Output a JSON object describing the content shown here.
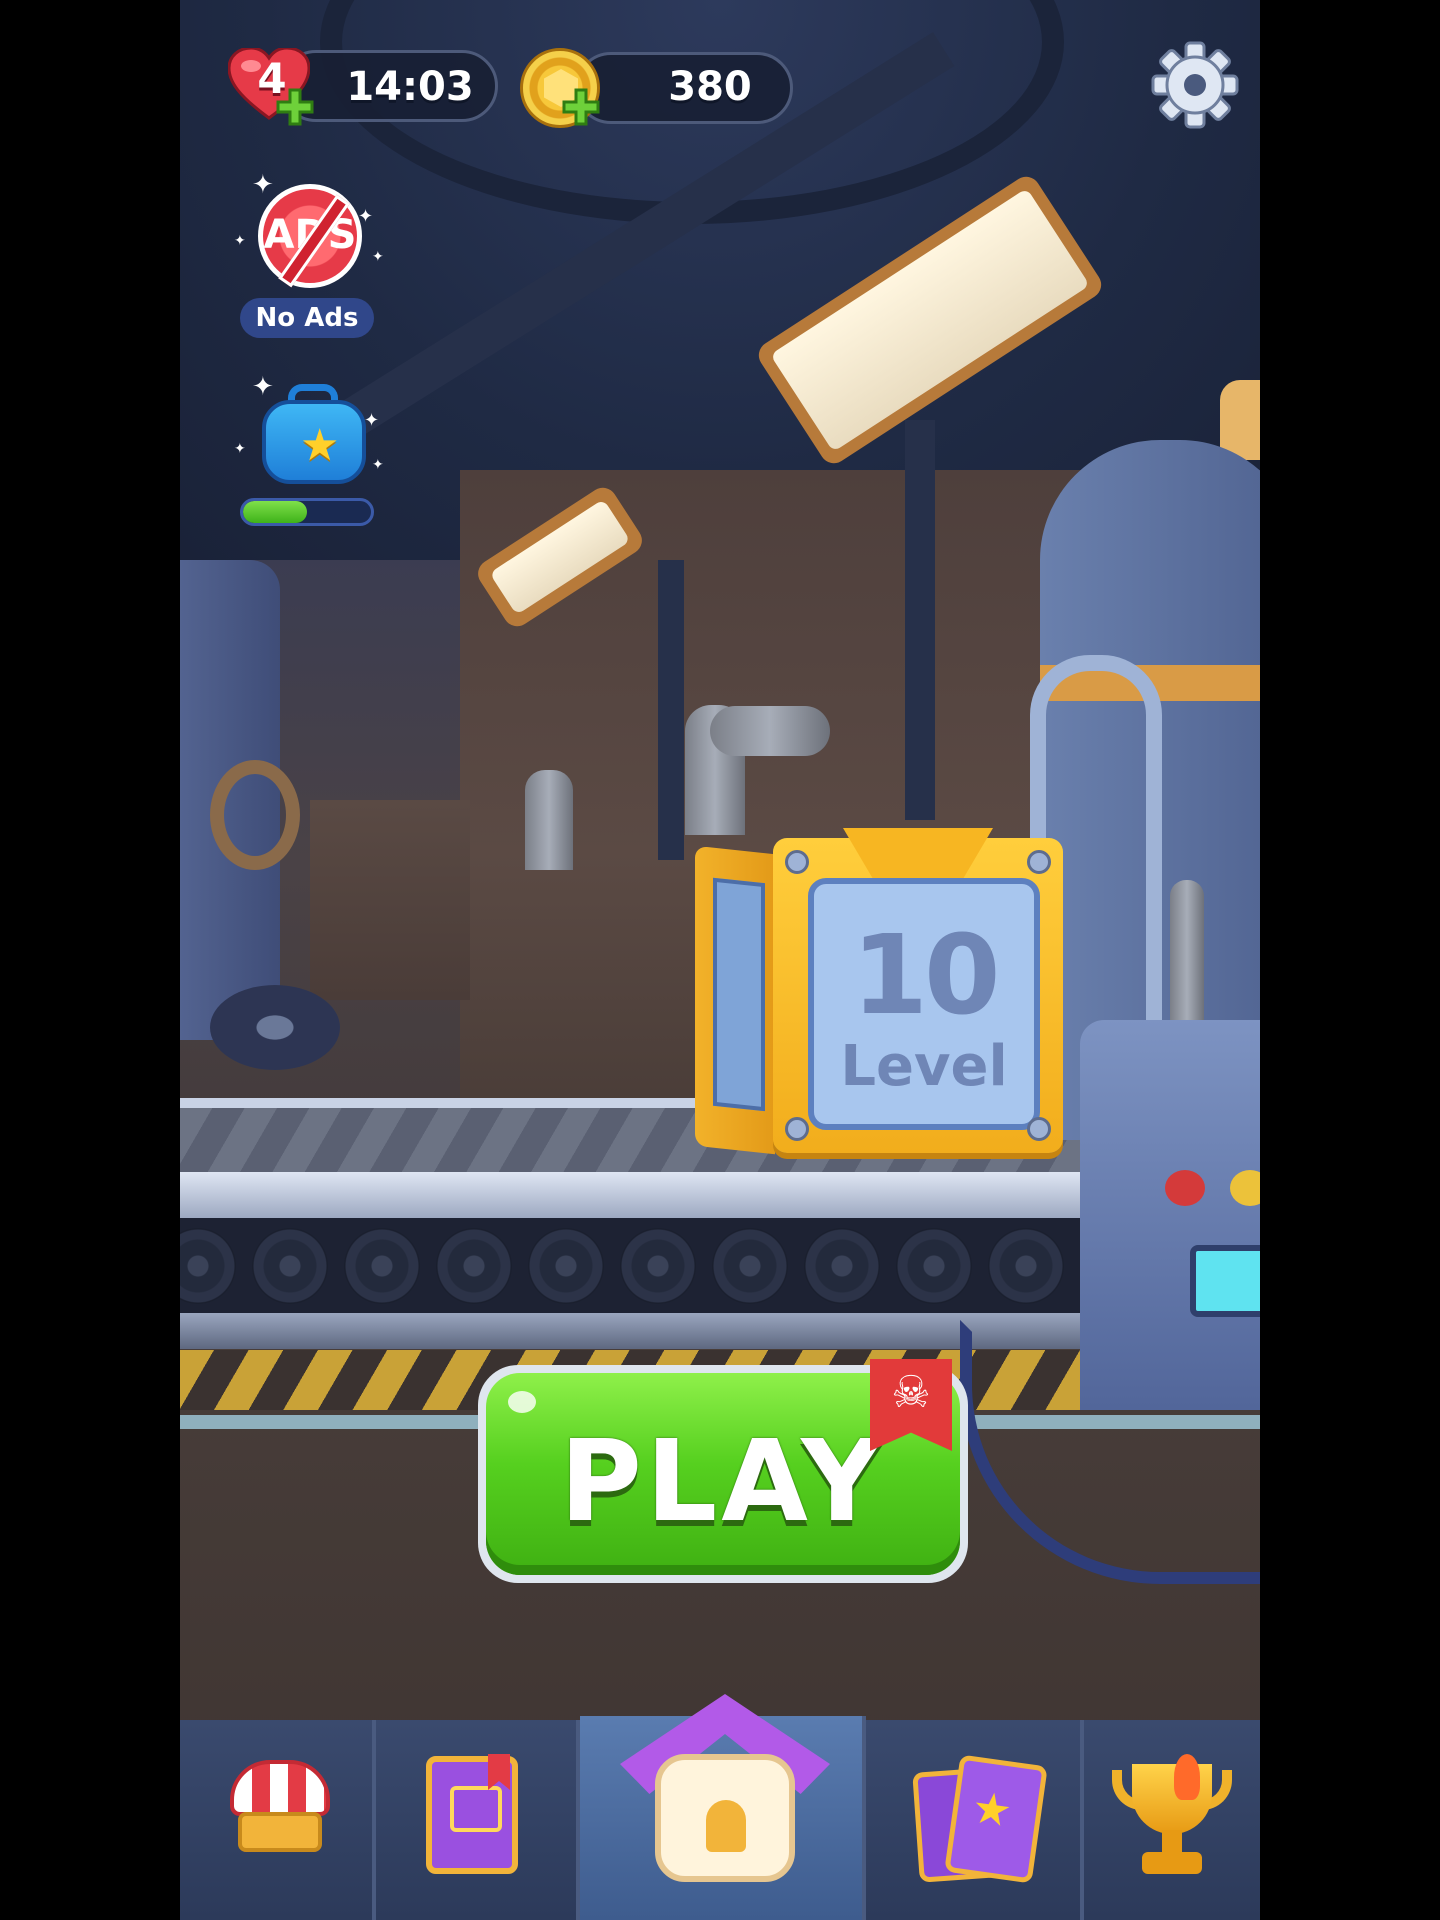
{
  "hud": {
    "lives": "4",
    "life_timer": "14:03",
    "coins": "380"
  },
  "side_offers": {
    "no_ads_badge": "ADS",
    "no_ads_label": "No Ads",
    "chest_progress": 0.5
  },
  "level": {
    "number": "10",
    "label": "Level"
  },
  "play_button": {
    "label": "PLAY",
    "badge_icon": "skull-icon"
  },
  "nav": {
    "tabs": [
      {
        "icon": "shop-icon",
        "active": false
      },
      {
        "icon": "album-icon",
        "active": false
      },
      {
        "icon": "home-icon",
        "active": true
      },
      {
        "icon": "cards-icon",
        "active": false
      },
      {
        "icon": "trophy-icon",
        "active": false
      }
    ]
  },
  "colors": {
    "play_green": "#56d01f",
    "crate_gold": "#f2ad1c",
    "crate_face_blue": "#a8c6ee",
    "nav_bg": "#2e3b5a",
    "home_roof_purple": "#b25ae8",
    "heart_red": "#e63a48"
  }
}
